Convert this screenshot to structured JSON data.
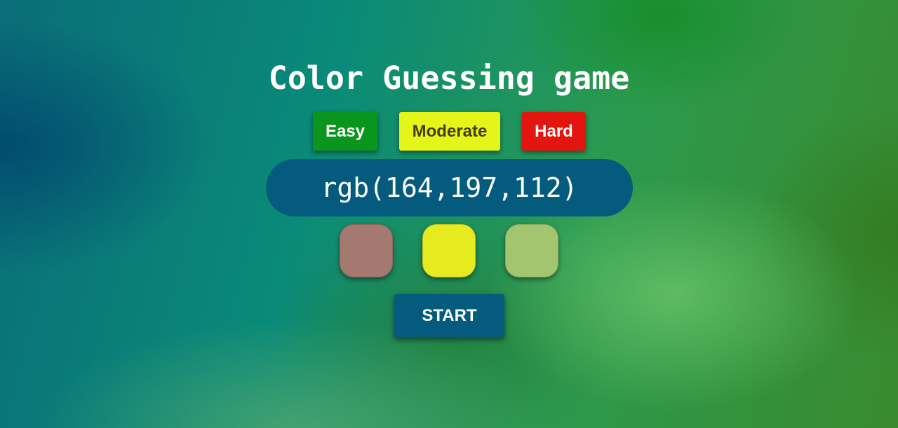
{
  "game": {
    "title": "Color Guessing game",
    "levels": {
      "easy": {
        "label": "Easy",
        "color": "#0a961e"
      },
      "moderate": {
        "label": "Moderate",
        "color": "#e4f51a"
      },
      "hard": {
        "label": "Hard",
        "color": "#e3150f"
      }
    },
    "target_rgb": "rgb(164,197,112)",
    "swatches": [
      {
        "color": "#a57870"
      },
      {
        "color": "#e6eb20"
      },
      {
        "color": "#a4c570"
      }
    ],
    "start_label": "START"
  },
  "colors": {
    "display_bg": "#055b7e",
    "title_text": "#ffffff"
  }
}
